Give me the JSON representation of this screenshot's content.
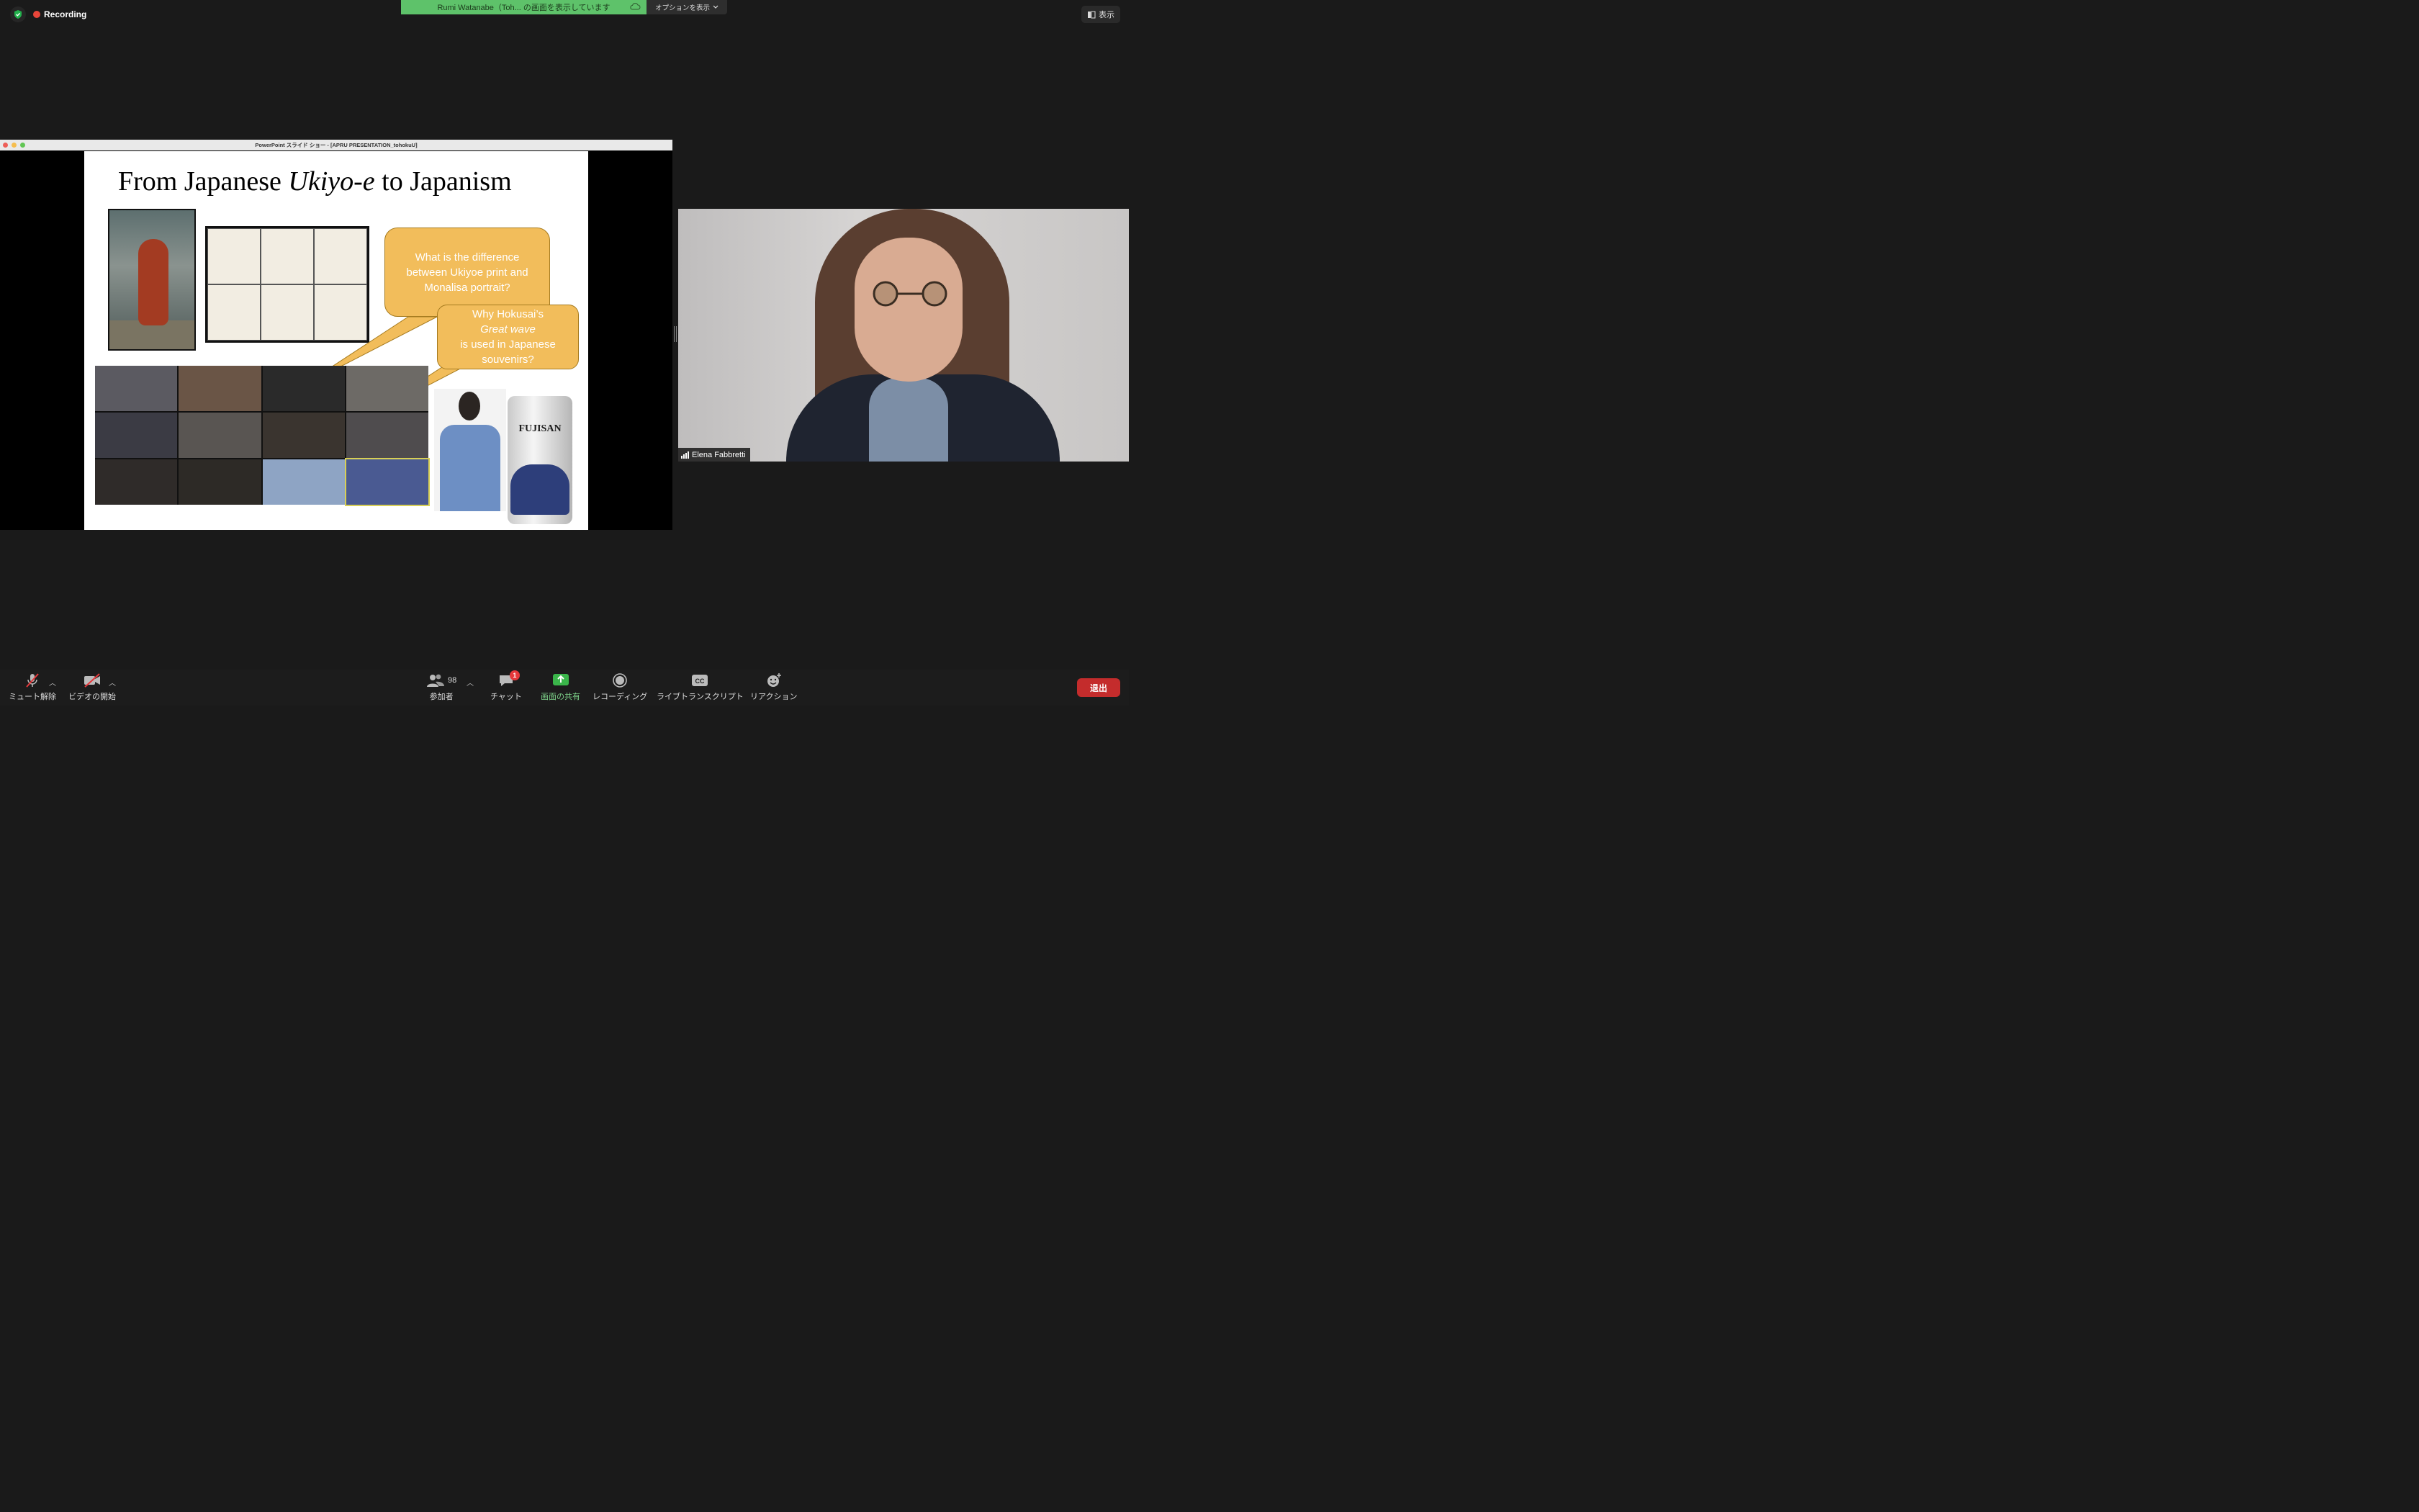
{
  "top": {
    "recording_label": "Recording",
    "share_banner": "Rumi Watanabe（Toh... の画面を表示しています",
    "options_label": "オプションを表示",
    "view_label": "表示"
  },
  "shared_window": {
    "title": "PowerPoint スライド ショー - [APRU PRESENTATION_tohokuU]"
  },
  "slide": {
    "title_start": "From Japanese ",
    "title_italic": "Ukiyo-e",
    "title_end": " to Japanism",
    "bubble1_lines": [
      "What is the difference",
      "between Ukiyoe print and",
      "Monalisa portrait?"
    ],
    "bubble2_line1": "Why Hokusai’s",
    "bubble2_italic": "Great wave",
    "bubble2_line3": "is used in Japanese",
    "bubble2_line4": "souvenirs?",
    "can_brand": "FUJISAN"
  },
  "video": {
    "participant_name": "Elena Fabbretti"
  },
  "toolbar": {
    "mute_label": "ミュート解除",
    "video_label": "ビデオの開始",
    "participants_label": "参加者",
    "participants_count": "98",
    "chat_label": "チャット",
    "chat_badge": "1",
    "share_label": "画面の共有",
    "recording_label": "レコーディング",
    "transcript_label": "ライブトランスクリプト",
    "cc_text": "CC",
    "reaction_label": "リアクション",
    "leave_label": "退出"
  },
  "colors": {
    "share_green": "#5ec26a",
    "leave_red": "#c42c2c",
    "bubble_gold": "#f2bd5b",
    "record_red": "#e8463a"
  }
}
